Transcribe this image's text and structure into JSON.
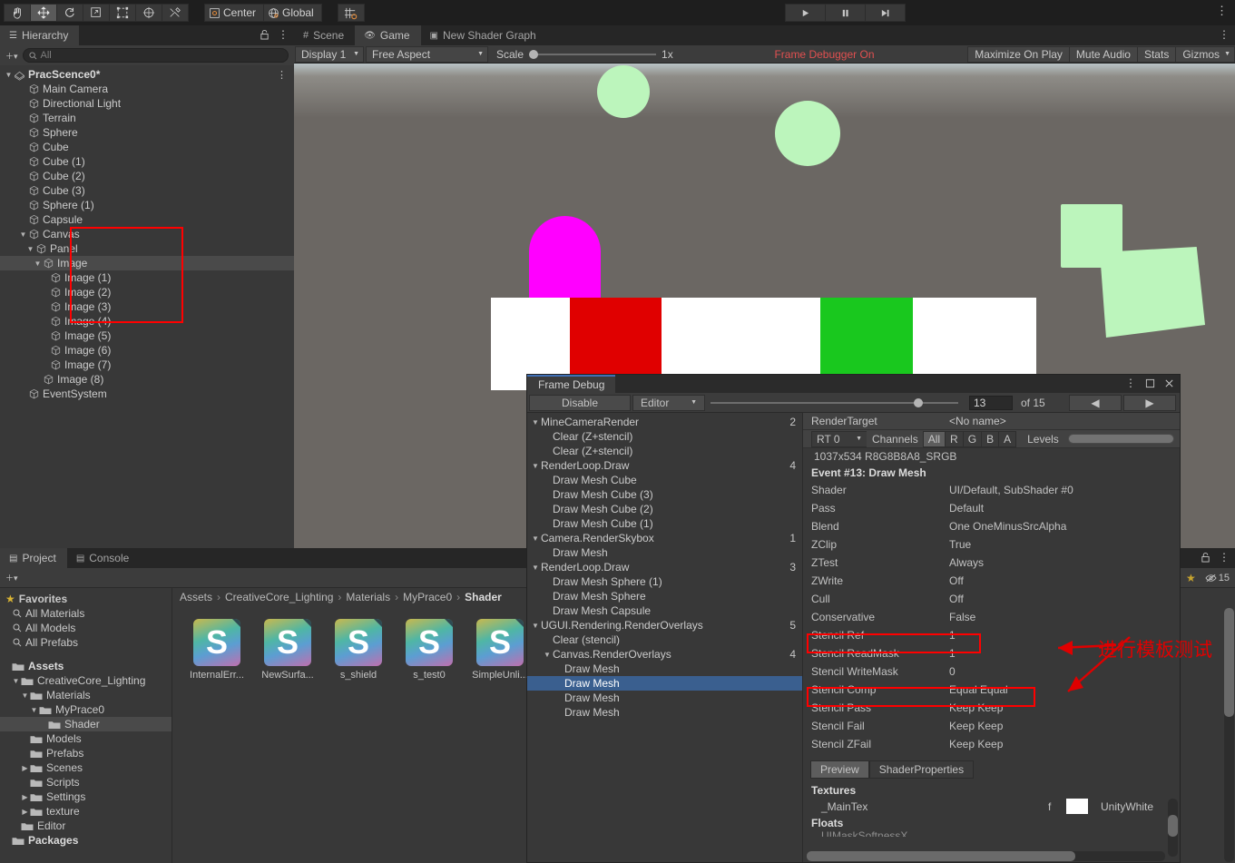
{
  "toolbar": {
    "tools": [
      {
        "name": "hand-tool",
        "icon": "✋"
      },
      {
        "name": "move-tool",
        "icon": "✥"
      },
      {
        "name": "rotate-tool",
        "icon": "↻"
      },
      {
        "name": "scale-tool",
        "icon": "⤢"
      },
      {
        "name": "rect-tool",
        "icon": "⬚"
      },
      {
        "name": "transform-tool",
        "icon": "✧"
      },
      {
        "name": "custom-tool",
        "icon": "⚒"
      }
    ],
    "pivot_label": "Center",
    "space_label": "Global",
    "snap_label": "",
    "play_label": "▶",
    "pause_label": "❚❚",
    "step_label": "▶❙"
  },
  "hierarchy": {
    "tab_label": "Hierarchy",
    "search_placeholder": "All",
    "items": [
      {
        "label": "PracScence0*",
        "depth": 0,
        "arrow": "▼",
        "icon": "scene",
        "menu": "⋮"
      },
      {
        "label": "Main Camera",
        "depth": 2,
        "arrow": "",
        "icon": "cube"
      },
      {
        "label": "Directional Light",
        "depth": 2,
        "arrow": "",
        "icon": "cube"
      },
      {
        "label": "Terrain",
        "depth": 2,
        "arrow": "",
        "icon": "cube"
      },
      {
        "label": "Sphere",
        "depth": 2,
        "arrow": "",
        "icon": "cube"
      },
      {
        "label": "Cube",
        "depth": 2,
        "arrow": "",
        "icon": "cube"
      },
      {
        "label": "Cube (1)",
        "depth": 2,
        "arrow": "",
        "icon": "cube"
      },
      {
        "label": "Cube (2)",
        "depth": 2,
        "arrow": "",
        "icon": "cube"
      },
      {
        "label": "Cube (3)",
        "depth": 2,
        "arrow": "",
        "icon": "cube"
      },
      {
        "label": "Sphere (1)",
        "depth": 2,
        "arrow": "",
        "icon": "cube"
      },
      {
        "label": "Capsule",
        "depth": 2,
        "arrow": "",
        "icon": "cube"
      },
      {
        "label": "Canvas",
        "depth": 2,
        "arrow": "▼",
        "icon": "cube"
      },
      {
        "label": "Panel",
        "depth": 3,
        "arrow": "▼",
        "icon": "cube"
      },
      {
        "label": "Image",
        "depth": 4,
        "arrow": "▼",
        "icon": "cube",
        "selected": true
      },
      {
        "label": "Image (1)",
        "depth": 5,
        "arrow": "",
        "icon": "cube"
      },
      {
        "label": "Image (2)",
        "depth": 5,
        "arrow": "",
        "icon": "cube"
      },
      {
        "label": "Image (3)",
        "depth": 5,
        "arrow": "",
        "icon": "cube"
      },
      {
        "label": "Image (4)",
        "depth": 5,
        "arrow": "",
        "icon": "cube"
      },
      {
        "label": "Image (5)",
        "depth": 5,
        "arrow": "",
        "icon": "cube"
      },
      {
        "label": "Image (6)",
        "depth": 5,
        "arrow": "",
        "icon": "cube"
      },
      {
        "label": "Image (7)",
        "depth": 5,
        "arrow": "",
        "icon": "cube"
      },
      {
        "label": "Image (8)",
        "depth": 4,
        "arrow": "",
        "icon": "cube"
      },
      {
        "label": "EventSystem",
        "depth": 2,
        "arrow": "",
        "icon": "cube"
      }
    ]
  },
  "gameview": {
    "tabs": [
      {
        "label": "Scene",
        "icon": "#",
        "active": false
      },
      {
        "label": "Game",
        "icon": "👁",
        "active": true
      },
      {
        "label": "New Shader Graph",
        "icon": "▣",
        "active": false
      }
    ],
    "display": "Display 1",
    "aspect": "Free Aspect",
    "scale_label": "Scale",
    "scale_value": "1x",
    "frame_debugger_status": "Frame Debugger On",
    "maximize_on_play": "Maximize On Play",
    "mute_audio": "Mute Audio",
    "stats": "Stats",
    "gizmos": "Gizmos"
  },
  "frame_debug": {
    "title": "Frame Debug",
    "disable_label": "Disable",
    "target_label": "Editor",
    "event_index": "13",
    "event_total": "of 15",
    "prev_label": "◀",
    "next_label": "▶",
    "tree": [
      {
        "label": "MineCameraRender",
        "depth": 0,
        "arrow": "▼",
        "count": "2"
      },
      {
        "label": "Clear (Z+stencil)",
        "depth": 1,
        "arrow": "",
        "count": ""
      },
      {
        "label": "Clear (Z+stencil)",
        "depth": 1,
        "arrow": "",
        "count": ""
      },
      {
        "label": "RenderLoop.Draw",
        "depth": 0,
        "arrow": "▼",
        "count": "4"
      },
      {
        "label": "Draw Mesh Cube",
        "depth": 1,
        "arrow": "",
        "count": ""
      },
      {
        "label": "Draw Mesh Cube (3)",
        "depth": 1,
        "arrow": "",
        "count": ""
      },
      {
        "label": "Draw Mesh Cube (2)",
        "depth": 1,
        "arrow": "",
        "count": ""
      },
      {
        "label": "Draw Mesh Cube (1)",
        "depth": 1,
        "arrow": "",
        "count": ""
      },
      {
        "label": "Camera.RenderSkybox",
        "depth": 0,
        "arrow": "▼",
        "count": "1"
      },
      {
        "label": "Draw Mesh",
        "depth": 1,
        "arrow": "",
        "count": ""
      },
      {
        "label": "RenderLoop.Draw",
        "depth": 0,
        "arrow": "▼",
        "count": "3"
      },
      {
        "label": "Draw Mesh Sphere (1)",
        "depth": 1,
        "arrow": "",
        "count": ""
      },
      {
        "label": "Draw Mesh Sphere",
        "depth": 1,
        "arrow": "",
        "count": ""
      },
      {
        "label": "Draw Mesh Capsule",
        "depth": 1,
        "arrow": "",
        "count": ""
      },
      {
        "label": "UGUI.Rendering.RenderOverlays",
        "depth": 0,
        "arrow": "▼",
        "count": "5"
      },
      {
        "label": "Clear (stencil)",
        "depth": 1,
        "arrow": "",
        "count": ""
      },
      {
        "label": "Canvas.RenderOverlays",
        "depth": 1,
        "arrow": "▼",
        "count": "4"
      },
      {
        "label": "Draw Mesh",
        "depth": 2,
        "arrow": "",
        "count": ""
      },
      {
        "label": "Draw Mesh",
        "depth": 2,
        "arrow": "",
        "count": "",
        "selected": true
      },
      {
        "label": "Draw Mesh",
        "depth": 2,
        "arrow": "",
        "count": ""
      },
      {
        "label": "Draw Mesh",
        "depth": 2,
        "arrow": "",
        "count": ""
      }
    ],
    "render_target_label": "RenderTarget",
    "render_target_value": "<No name>",
    "rt_select": "RT 0",
    "channels_label": "Channels",
    "channels": [
      "All",
      "R",
      "G",
      "B",
      "A"
    ],
    "channels_active": "All",
    "levels_label": "Levels",
    "resolution": "1037x534 R8G8B8A8_SRGB",
    "event_title": "Event #13: Draw Mesh",
    "properties": [
      {
        "key": "Shader",
        "value": "UI/Default, SubShader #0"
      },
      {
        "key": "Pass",
        "value": "Default"
      },
      {
        "key": "Blend",
        "value": "One OneMinusSrcAlpha"
      },
      {
        "key": "ZClip",
        "value": "True"
      },
      {
        "key": "ZTest",
        "value": "Always"
      },
      {
        "key": "ZWrite",
        "value": "Off"
      },
      {
        "key": "Cull",
        "value": "Off"
      },
      {
        "key": "Conservative",
        "value": "False"
      },
      {
        "key": "Stencil Ref",
        "value": "1",
        "highlight": true
      },
      {
        "key": "Stencil ReadMask",
        "value": "1"
      },
      {
        "key": "Stencil WriteMask",
        "value": "0"
      },
      {
        "key": "Stencil Comp",
        "value": "Equal Equal",
        "highlight": true
      },
      {
        "key": "Stencil Pass",
        "value": "Keep Keep"
      },
      {
        "key": "Stencil Fail",
        "value": "Keep Keep"
      },
      {
        "key": "Stencil ZFail",
        "value": "Keep Keep"
      }
    ],
    "bottom_tabs": [
      {
        "label": "Preview",
        "active": true
      },
      {
        "label": "ShaderProperties",
        "active": false
      }
    ],
    "textures_header": "Textures",
    "texture_name": "_MainTex",
    "texture_flag": "f",
    "texture_value": "UnityWhite",
    "floats_header": "Floats",
    "float_name": "UIMaskSoftnessX",
    "annotation": "进行模板测试"
  },
  "project": {
    "tabs": [
      {
        "label": "Project",
        "icon": "",
        "active": true
      },
      {
        "label": "Console",
        "icon": "▤",
        "active": false
      }
    ],
    "eye_count": "15",
    "favorites_label": "Favorites",
    "favorites": [
      "All Materials",
      "All Models",
      "All Prefabs"
    ],
    "tree": [
      {
        "label": "Assets",
        "depth": 0,
        "arrow": "",
        "bold": true
      },
      {
        "label": "CreativeCore_Lighting",
        "depth": 1,
        "arrow": "▼"
      },
      {
        "label": "Materials",
        "depth": 2,
        "arrow": "▼"
      },
      {
        "label": "MyPrace0",
        "depth": 3,
        "arrow": "▼"
      },
      {
        "label": "Shader",
        "depth": 4,
        "arrow": "",
        "selected": true
      },
      {
        "label": "Models",
        "depth": 2,
        "arrow": ""
      },
      {
        "label": "Prefabs",
        "depth": 2,
        "arrow": ""
      },
      {
        "label": "Scenes",
        "depth": 2,
        "arrow": "▶"
      },
      {
        "label": "Scripts",
        "depth": 2,
        "arrow": ""
      },
      {
        "label": "Settings",
        "depth": 2,
        "arrow": "▶"
      },
      {
        "label": "texture",
        "depth": 2,
        "arrow": "▶"
      },
      {
        "label": "Editor",
        "depth": 1,
        "arrow": ""
      },
      {
        "label": "Packages",
        "depth": 0,
        "arrow": "",
        "bold": true
      }
    ],
    "breadcrumb": [
      "Assets",
      "CreativeCore_Lighting",
      "Materials",
      "MyPrace0",
      "Shader"
    ],
    "assets": [
      {
        "label": "InternalErr...",
        "glyph": "S"
      },
      {
        "label": "NewSurfa...",
        "glyph": "S"
      },
      {
        "label": "s_shield",
        "glyph": "S"
      },
      {
        "label": "s_test0",
        "glyph": "S"
      },
      {
        "label": "SimpleUnli...",
        "glyph": "S"
      }
    ]
  },
  "gameshapes": {
    "sky_top": "#b9c3c6",
    "ground": "#6b6763",
    "pale_green": "#bcf5bc",
    "magenta": "#ff00ff",
    "red": "#e00000",
    "green": "#19c81e",
    "white": "#ffffff"
  }
}
